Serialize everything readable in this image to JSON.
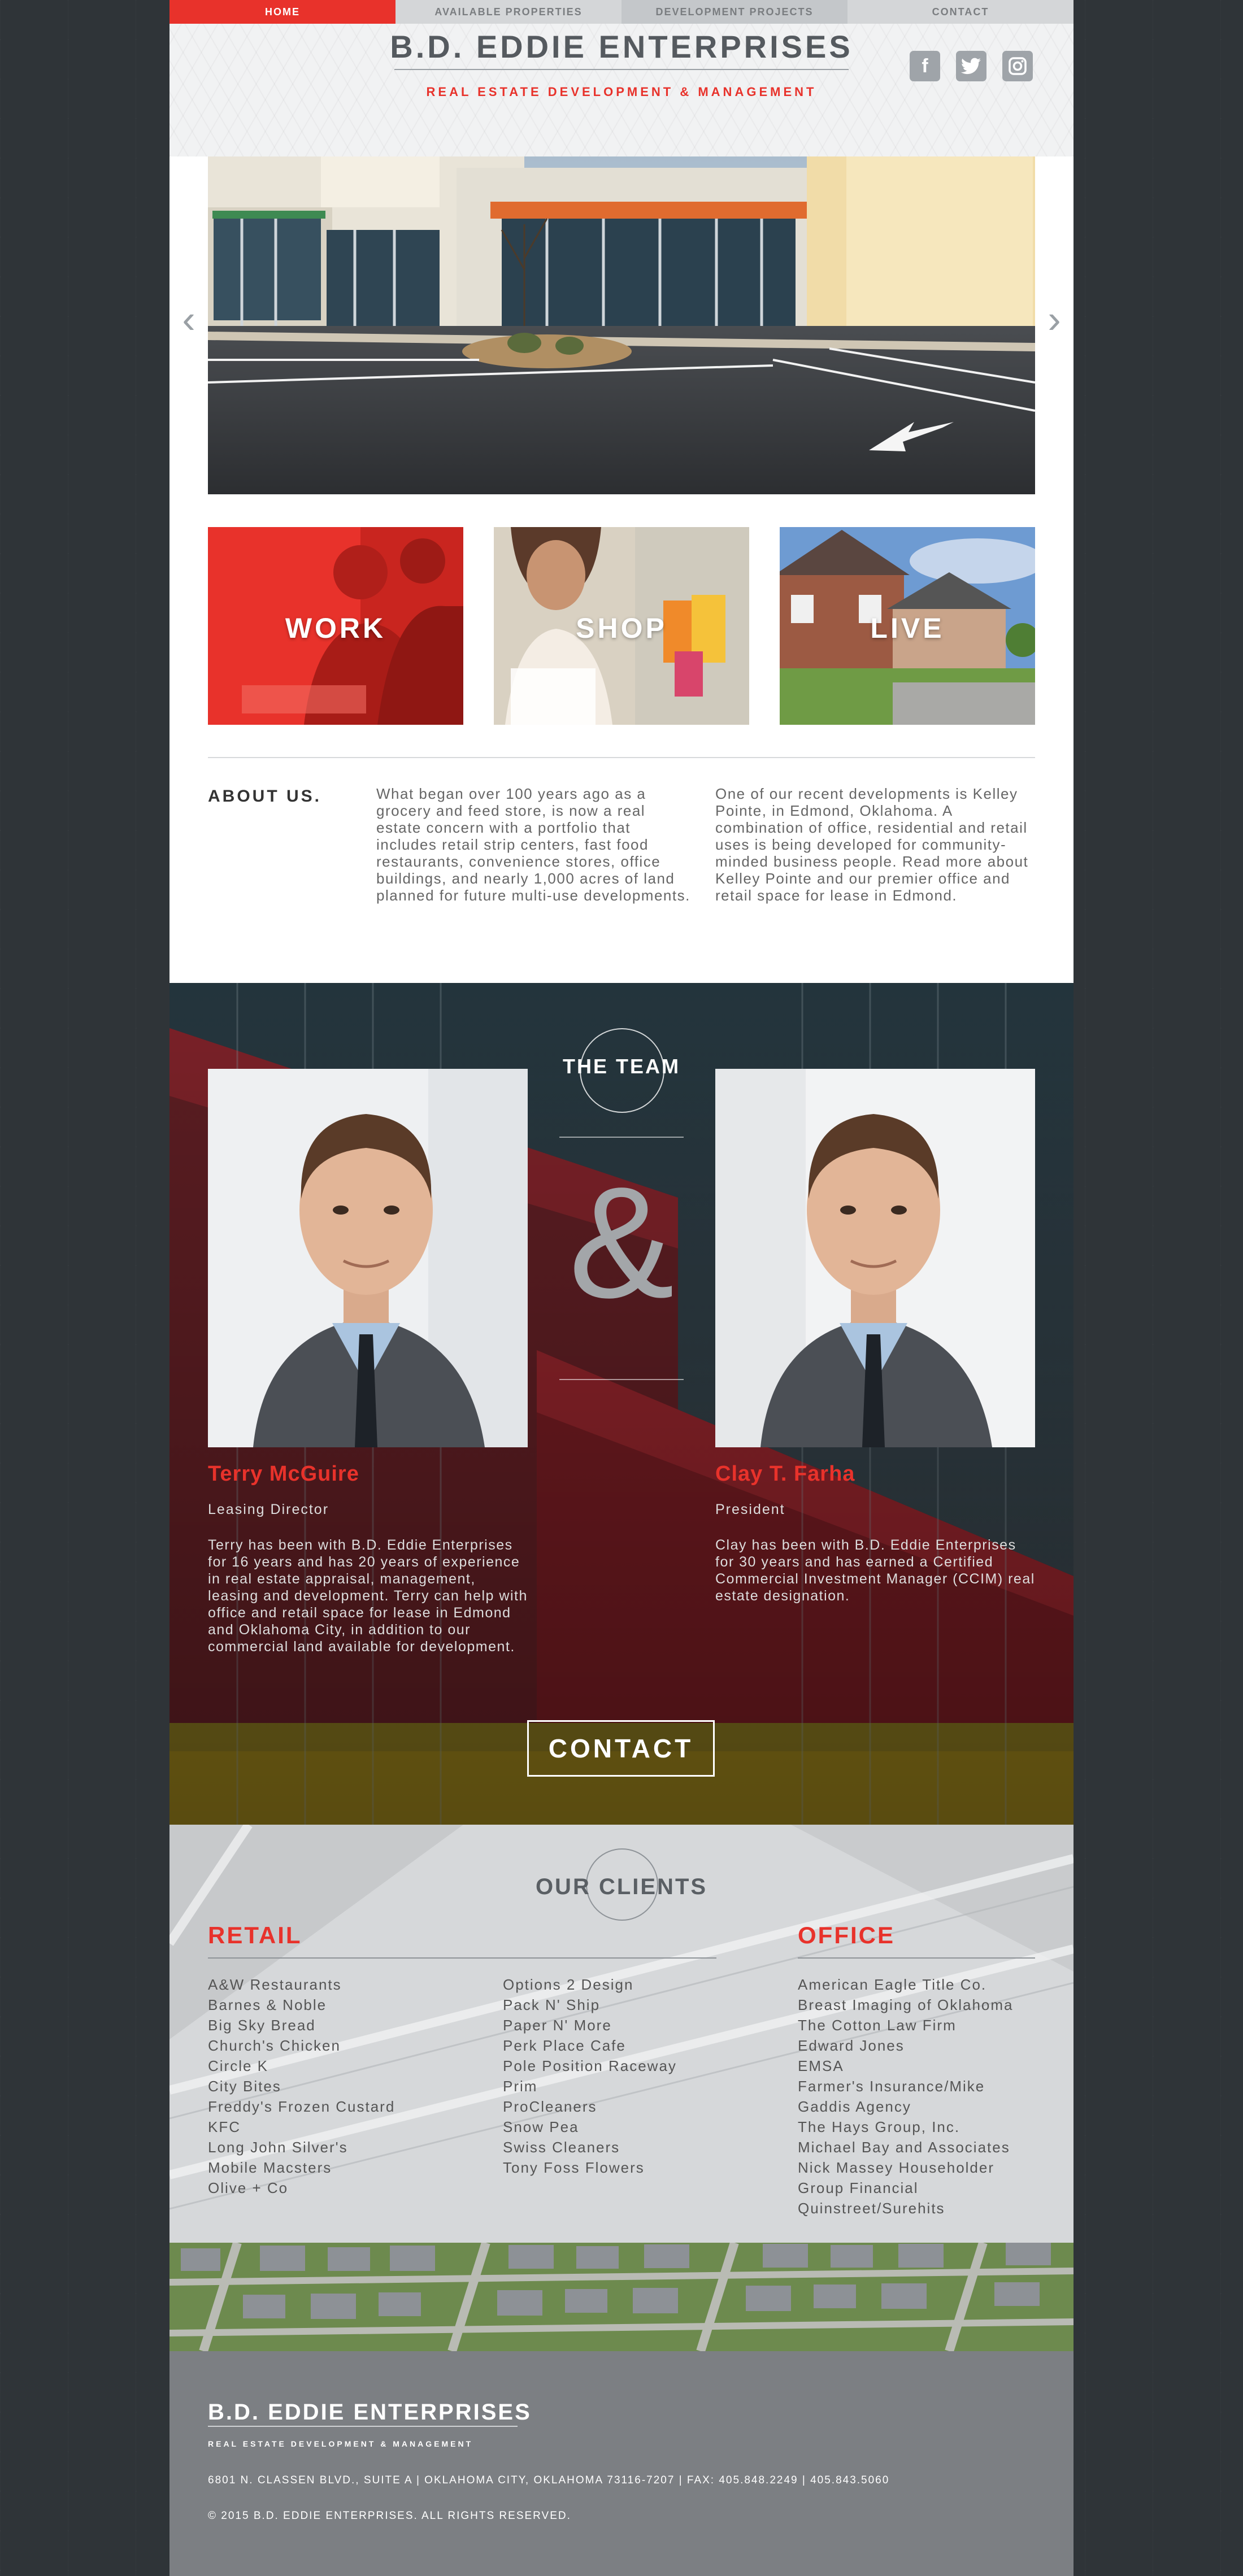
{
  "nav": {
    "items": [
      "HOME",
      "AVAILABLE PROPERTIES",
      "DEVELOPMENT PROJECTS",
      "CONTACT"
    ]
  },
  "header": {
    "title": "B.D. EDDIE ENTERPRISES",
    "tagline": "REAL ESTATE DEVELOPMENT & MANAGEMENT",
    "social": [
      "facebook-icon",
      "twitter-icon",
      "instagram-icon"
    ]
  },
  "tiles": [
    "WORK",
    "SHOP",
    "LIVE"
  ],
  "about": {
    "heading": "ABOUT US.",
    "col1": "What began over 100 years ago as a grocery and feed store, is now a real estate concern with a portfolio that includes retail strip centers, fast food restaurants, convenience stores, office buildings, and nearly 1,000 acres of land planned for future multi-use developments.",
    "col2": "One of our recent developments is Kelley Pointe, in Edmond, Oklahoma. A combination of office, residential and retail uses is being developed for community-minded business people. Read more about Kelley Pointe and our premier office and retail space for lease in Edmond."
  },
  "team": {
    "title": "THE TEAM",
    "amp": "&",
    "members": [
      {
        "name": "Terry McGuire",
        "role": "Leasing Director",
        "bio": "Terry has been with B.D. Eddie Enterprises for 16 years and has 20 years of experience in real estate appraisal, management, leasing and development. Terry can help with office and retail space for lease in Edmond and Oklahoma City, in addition to our commercial land available for development."
      },
      {
        "name": "Clay T. Farha",
        "role": "President",
        "bio": "Clay has been with B.D. Eddie Enterprises for 30 years and has earned a Certified Commercial Investment Manager (CCIM) real estate designation."
      }
    ],
    "contact_label": "CONTACT"
  },
  "clients": {
    "title": "OUR CLIENTS",
    "retail_heading": "RETAIL",
    "office_heading": "OFFICE",
    "retail_col1": [
      "A&W Restaurants",
      "Barnes & Noble",
      "Big Sky Bread",
      "Church's Chicken",
      "Circle K",
      "City Bites",
      "Freddy's Frozen Custard",
      "KFC",
      "Long John Silver's",
      "Mobile Macsters",
      "Olive + Co"
    ],
    "retail_col2": [
      "Options 2 Design",
      "Pack N' Ship",
      "Paper N' More",
      "Perk Place Cafe",
      "Pole Position Raceway",
      "Prim",
      "ProCleaners",
      "Snow Pea",
      "Swiss Cleaners",
      "Tony Foss Flowers"
    ],
    "office": [
      "American Eagle Title Co.",
      "Breast Imaging of Oklahoma",
      "The Cotton Law Firm",
      "Edward Jones",
      "EMSA",
      "Farmer's Insurance/Mike",
      "Gaddis Agency",
      "The Hays Group, Inc.",
      "Michael Bay and Associates",
      "Nick Massey Householder",
      "Group Financial",
      "Quinstreet/Surehits"
    ]
  },
  "footer": {
    "title": "B.D. EDDIE ENTERPRISES",
    "tagline": "REAL ESTATE DEVELOPMENT & MANAGEMENT",
    "address": "6801 N. CLASSEN BLVD., SUITE A | OKLAHOMA CITY, OKLAHOMA 73116-7207 | FAX: 405.848.2249 | 405.843.5060",
    "copyright": "© 2015 B.D. EDDIE ENTERPRISES. ALL RIGHTS RESERVED."
  },
  "colors": {
    "accent": "#e8322b",
    "text": "#555a5f",
    "background": "#2f3438",
    "footer": "#7c7f83"
  }
}
